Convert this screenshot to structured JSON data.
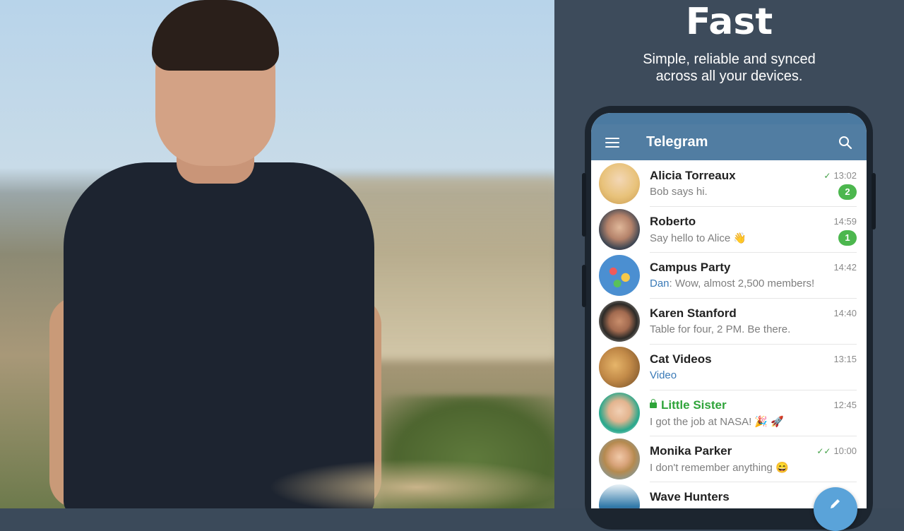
{
  "promo": {
    "title": "Fast",
    "subtitle_line1": "Simple, reliable and synced",
    "subtitle_line2": "across all your devices."
  },
  "app": {
    "title": "Telegram",
    "accent_color": "#517da2",
    "menu_icon": "hamburger-menu-icon",
    "search_icon": "search-icon"
  },
  "chats": [
    {
      "name": "Alicia Torreaux",
      "time": "13:02",
      "status": "sent",
      "preview": "Bob says hi.",
      "unread": "2",
      "avatar_color": "#e8c27a"
    },
    {
      "name": "Roberto",
      "time": "14:59",
      "preview": "Say hello to Alice 👋",
      "unread": "1",
      "avatar_color": "#3b4552"
    },
    {
      "name": "Campus Party",
      "time": "14:42",
      "sender": "Dan",
      "preview": ": Wow, almost 2,500 members!",
      "avatar_color": "#4b8fd1"
    },
    {
      "name": "Karen Stanford",
      "time": "14:40",
      "preview": "Table for four, 2 PM. Be there.",
      "avatar_color": "#2c2a27"
    },
    {
      "name": "Cat Videos",
      "time": "13:15",
      "preview": "Video",
      "avatar_color": "#c28a48"
    },
    {
      "name": "Little Sister",
      "time": "12:45",
      "secret": true,
      "preview": "I got the job at NASA! 🎉 🚀",
      "avatar_color": "#27a88c"
    },
    {
      "name": "Monika Parker",
      "time": "10:00",
      "status": "read",
      "preview": "I don't remember anything 😄",
      "avatar_color": "#6aa1c4"
    },
    {
      "name": "Wave Hunters",
      "time": "",
      "preview": "",
      "avatar_color": "#2f78a8"
    }
  ],
  "fab": {
    "icon": "pencil-icon",
    "color": "#5aa3d9"
  },
  "badge_color": "#4cb74e"
}
